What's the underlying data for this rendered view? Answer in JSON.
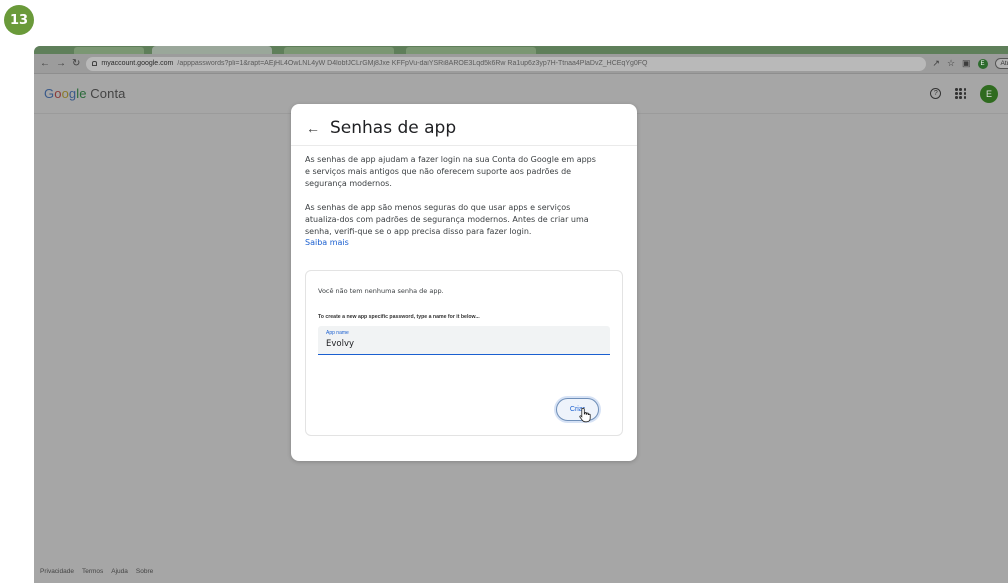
{
  "step": "13",
  "browser": {
    "url_host": "myaccount.google.com",
    "url_rest": "/apppasswords?pli=1&rapt=AEjHL4OwLNL4yW D4lobfJCLrGMj8Jxe KFFpVu-daiYSRi8AROE3Lqd5k6Rw Ra1up6z3yp7H-Ttnaa4PlaDvZ_HCEqYg0FQ",
    "update_label": "Atualizar",
    "profile_initial": "E"
  },
  "header": {
    "logo_g1": "G",
    "logo_o1": "o",
    "logo_o2": "o",
    "logo_g2": "g",
    "logo_le": "le",
    "logo_product": "Conta",
    "avatar_initial": "E"
  },
  "modal": {
    "title": "Senhas de app",
    "para1": "As senhas de app ajudam a fazer login na sua Conta do Google em apps e serviços mais antigos que não oferecem suporte aos padrões de segurança modernos.",
    "para2": "As senhas de app são menos seguras do que usar apps e serviços atualiza-dos com padrões de segurança modernos. Antes de criar uma senha, verifi-que se o app precisa disso para fazer login.",
    "learn_more": "Saiba mais",
    "no_passwords": "Você não tem nenhuma senha de app.",
    "create_hint": "To create a new app specific password, type a name for it below...",
    "field_label": "App name",
    "field_value": "Evolvy",
    "create_button": "Criar"
  },
  "footer": {
    "links": [
      "Privacidade",
      "Termos",
      "Ajuda",
      "Sobre"
    ]
  }
}
